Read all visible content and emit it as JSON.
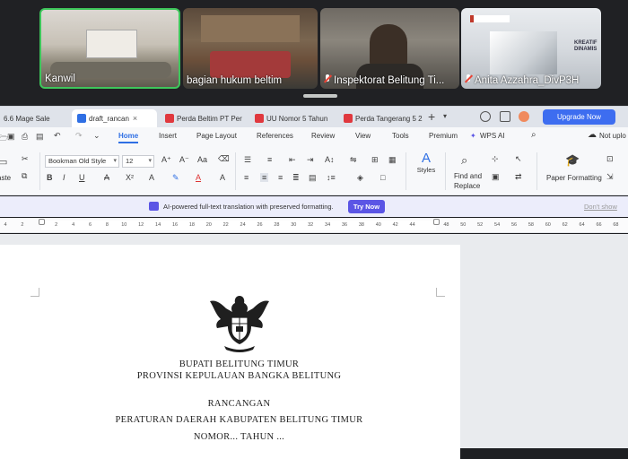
{
  "meeting": {
    "tiles": [
      {
        "name": "Kanwil",
        "muted": false
      },
      {
        "name": "bagian hukum beltim",
        "muted": false
      },
      {
        "name": "Inspektorat Belitung Ti...",
        "muted": true
      },
      {
        "name": "Anita Azzahra_DivP3H",
        "muted": true
      }
    ],
    "brand_text": "KREATIF DINAMIS"
  },
  "tabs": [
    {
      "label": "6.6 Mage Sale",
      "icon": "none",
      "active": false
    },
    {
      "label": "draft_rancan",
      "icon": "word-doc-icon",
      "active": true
    },
    {
      "label": "Perda Beltim PT Per",
      "icon": "pdf-icon",
      "active": false
    },
    {
      "label": "UU Nomor 5 Tahun",
      "icon": "pdf-icon",
      "active": false
    },
    {
      "label": "Perda Tangerang 5 2",
      "icon": "pdf-icon",
      "active": false
    }
  ],
  "upgrade_label": "Upgrade Now",
  "menu": {
    "items": [
      "Home",
      "Insert",
      "Page Layout",
      "References",
      "Review",
      "View",
      "Tools",
      "Premium"
    ],
    "active": "Home",
    "wps_ai": "WPS AI",
    "not_uploaded": "Not uplo"
  },
  "ribbon": {
    "font_family": "Bookman Old Style",
    "font_size": "12",
    "paste": "aste",
    "styles": "Styles",
    "find_replace_1": "Find and",
    "find_replace_2": "Replace",
    "paper_formatting": "Paper Formatting"
  },
  "banner": {
    "text": "AI-powered full-text translation with preserved formatting.",
    "try_label": "Try Now",
    "dont_show": "Don't show"
  },
  "ruler_ticks": [
    "4",
    "2",
    "",
    "2",
    "4",
    "6",
    "8",
    "10",
    "12",
    "14",
    "16",
    "18",
    "20",
    "22",
    "24",
    "26",
    "28",
    "30",
    "32",
    "34",
    "36",
    "38",
    "40",
    "42",
    "44",
    "",
    "48",
    "50",
    "52",
    "54",
    "56",
    "58",
    "60",
    "62",
    "64",
    "66",
    "68"
  ],
  "document": {
    "line1": "BUPATI BELITUNG TIMUR",
    "line2": "PROVINSI KEPULAUAN BANGKA BELITUNG",
    "line3": "RANCANGAN",
    "line4": "PERATURAN DAERAH KABUPATEN BELITUNG TIMUR",
    "line5": "NOMOR... TAHUN ..."
  }
}
